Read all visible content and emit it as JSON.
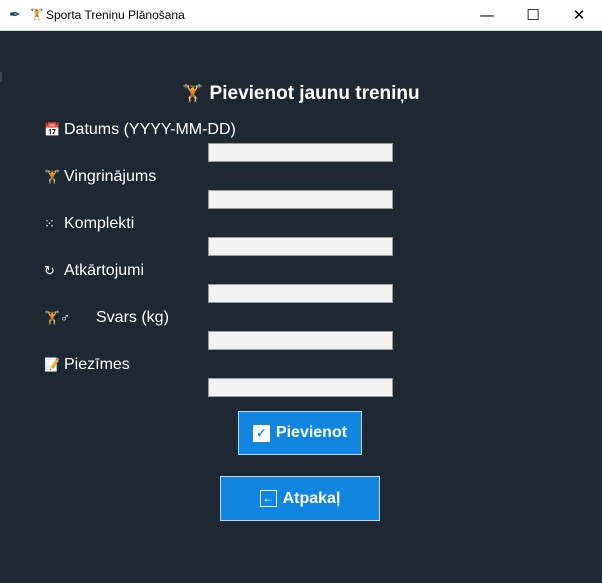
{
  "window": {
    "title": "Sporta Treniņu Plānošana",
    "app_icon": "feather-icon",
    "title_icon": "dumbbell-icon",
    "controls": {
      "minimize": "—",
      "maximize": "☐",
      "close": "✕"
    }
  },
  "form": {
    "heading": "Pievienot jaunu treniņu",
    "heading_icon": "🏋",
    "fields": [
      {
        "icon": "📅",
        "label": "Datums (YYYY-MM-DD)",
        "value": ""
      },
      {
        "icon": "🏋",
        "label": "Vingrinājums",
        "value": ""
      },
      {
        "icon": "⁙",
        "label": "Komplekti",
        "value": ""
      },
      {
        "icon": "↻",
        "label": "Atkārtojumi",
        "value": ""
      },
      {
        "icon": "🏋♂",
        "label": "Svars (kg)",
        "value": ""
      },
      {
        "icon": "📝",
        "label": "Piezīmes",
        "value": ""
      }
    ]
  },
  "buttons": {
    "add_label": "Pievienot",
    "add_icon": "✓",
    "back_label": "Atpakaļ",
    "back_icon": "←"
  },
  "colors": {
    "background": "#1e2833",
    "button": "#1186e0",
    "text": "#ffffff"
  }
}
